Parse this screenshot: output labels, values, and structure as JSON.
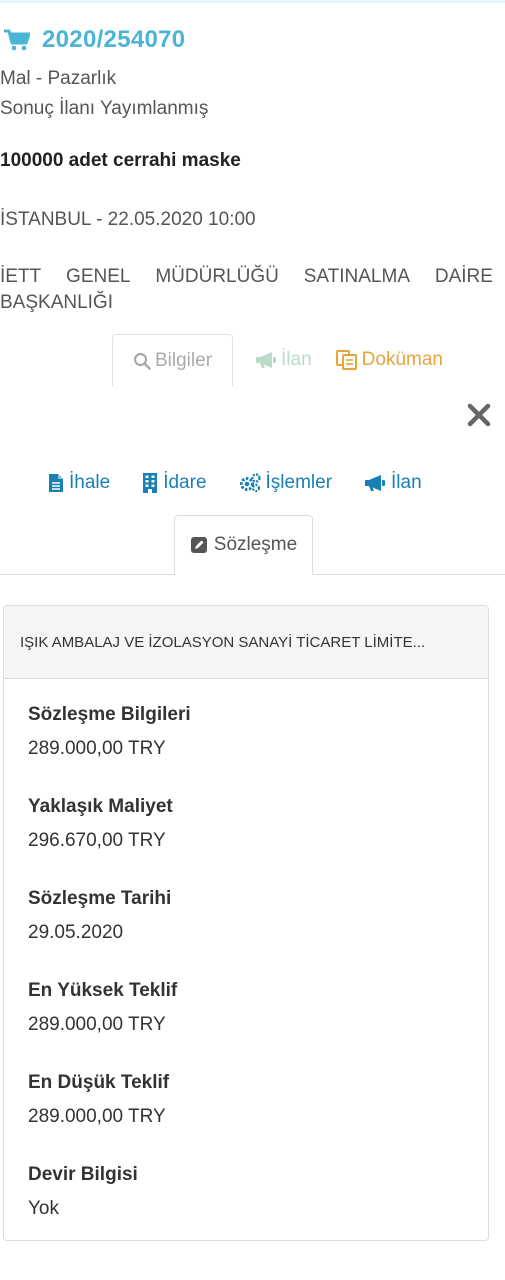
{
  "header": {
    "ihale_no": "2020/254070",
    "type": "Mal - Pazarlık",
    "status": "Sonuç İlanı Yayımlanmış",
    "title": "100000 adet cerrahi maske",
    "location_date": "İSTANBUL - 22.05.2020 10:00",
    "idare_words": [
      "İETT",
      "GENEL",
      "MÜDÜRLÜĞÜ",
      "SATINALMA",
      "DAİRE"
    ],
    "idare_line2": "BAŞKANLIĞI"
  },
  "tabs_top": {
    "bilgiler": "Bilgiler",
    "ilan": "İlan",
    "dokuman": "Doküman"
  },
  "tabs_sub": {
    "ihale": "İhale",
    "idare": "İdare",
    "islemler": "İşlemler",
    "ilan": "İlan",
    "sozlesme": "Sözleşme"
  },
  "contract": {
    "company": "IŞIK AMBALAJ VE İZOLASYON SANAYİ TİCARET LİMİTE...",
    "fields": [
      {
        "label": "Sözleşme Bilgileri",
        "value": "289.000,00 TRY"
      },
      {
        "label": "Yaklaşık Maliyet",
        "value": "296.670,00 TRY"
      },
      {
        "label": "Sözleşme Tarihi",
        "value": "29.05.2020"
      },
      {
        "label": "En Yüksek Teklif",
        "value": "289.000,00 TRY"
      },
      {
        "label": "En Düşük Teklif",
        "value": "289.000,00 TRY"
      },
      {
        "label": "Devir Bilgisi",
        "value": "Yok"
      }
    ]
  },
  "colors": {
    "accent": "#4bb5d6",
    "link": "#1a7fb4",
    "ilan_disabled": "#b9dcc6",
    "dokuman": "#e8a33a"
  }
}
